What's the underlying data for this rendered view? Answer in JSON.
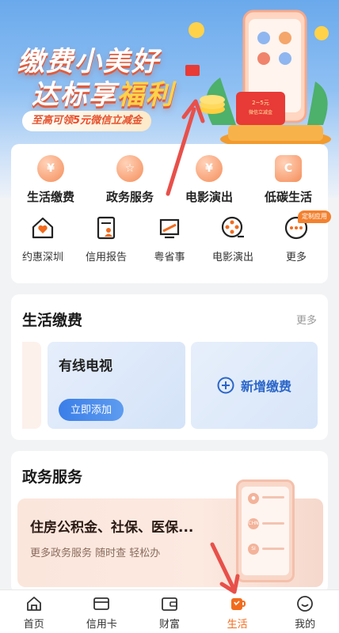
{
  "banner": {
    "title_line1": "缴费小美好",
    "title_line2_pre": "达标享",
    "title_line2_hl": "福利",
    "subtitle_pre": "至高可领",
    "subtitle_num": "5元",
    "subtitle_post": "微信立减金",
    "envelope_text": "2~5元 微信立减金"
  },
  "services_big": [
    {
      "label": "生活缴费",
      "glyph": "¥"
    },
    {
      "label": "政务服务",
      "glyph": "☆"
    },
    {
      "label": "电影演出",
      "glyph": "¥"
    },
    {
      "label": "低碳生活",
      "glyph": "C"
    }
  ],
  "services_small": [
    {
      "label": "约惠深圳"
    },
    {
      "label": "信用报告"
    },
    {
      "label": "粤省事"
    },
    {
      "label": "电影演出"
    },
    {
      "label": "更多"
    }
  ],
  "custom_badge": "定制应用",
  "life": {
    "title": "生活缴费",
    "more": "更多",
    "tile_title": "有线电视",
    "tile_button": "立即添加",
    "add_label": "新增缴费"
  },
  "gov": {
    "title": "政务服务",
    "banner_title": "住房公积金、社保、医保...",
    "banner_sub": "更多政务服务 随时查 轻松办",
    "phone_tags": [
      "",
      "CHN",
      "SI"
    ]
  },
  "tabs": [
    {
      "label": "首页",
      "icon": "home-icon"
    },
    {
      "label": "信用卡",
      "icon": "card-icon"
    },
    {
      "label": "财富",
      "icon": "wallet-icon"
    },
    {
      "label": "生活",
      "icon": "cup-icon",
      "active": true
    },
    {
      "label": "我的",
      "icon": "smile-icon"
    }
  ],
  "colors": {
    "accent": "#f26b1d",
    "blue": "#3a7ee8",
    "annotation_arrow": "#e8504a"
  }
}
